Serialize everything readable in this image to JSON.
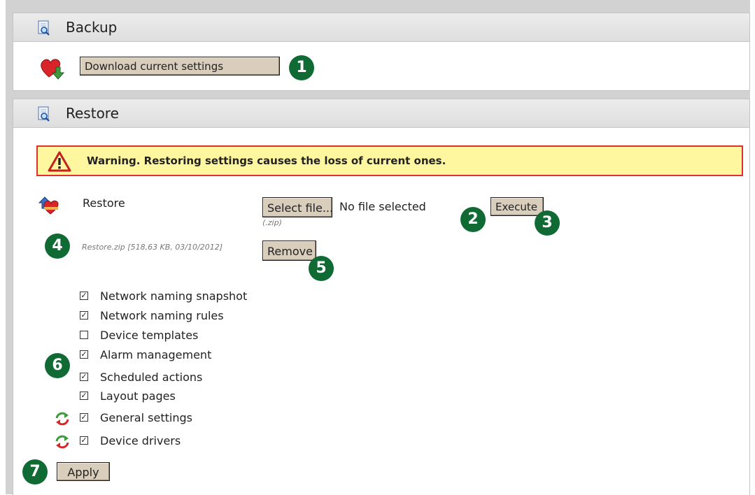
{
  "backup": {
    "title": "Backup",
    "download_label": "Download current settings"
  },
  "restore": {
    "title": "Restore",
    "warning": "Warning. Restoring settings causes the loss of current ones.",
    "row_label": "Restore",
    "select_file_label": "Select file...",
    "file_status": "No file selected",
    "file_hint": "(.zip)",
    "execute_label": "Execute",
    "current_file": "Restore.zip [518,63 KB, 03/10/2012]",
    "remove_label": "Remove",
    "options": [
      {
        "label": "Network naming snapshot",
        "checked": true
      },
      {
        "label": "Network naming rules",
        "checked": true
      },
      {
        "label": "Device templates",
        "checked": false
      },
      {
        "label": "Alarm management",
        "checked": true
      },
      {
        "label": "Scheduled actions",
        "checked": true
      },
      {
        "label": "Layout pages",
        "checked": true
      },
      {
        "label": "General settings",
        "checked": true
      },
      {
        "label": "Device drivers",
        "checked": true
      }
    ],
    "apply_label": "Apply"
  },
  "badges": [
    "1",
    "2",
    "3",
    "4",
    "5",
    "6",
    "7"
  ],
  "colors": {
    "badge": "#0f6a34",
    "warning_bg": "#fff6a0",
    "warning_border": "#e0302e",
    "button_bg": "#d9cdbc"
  }
}
